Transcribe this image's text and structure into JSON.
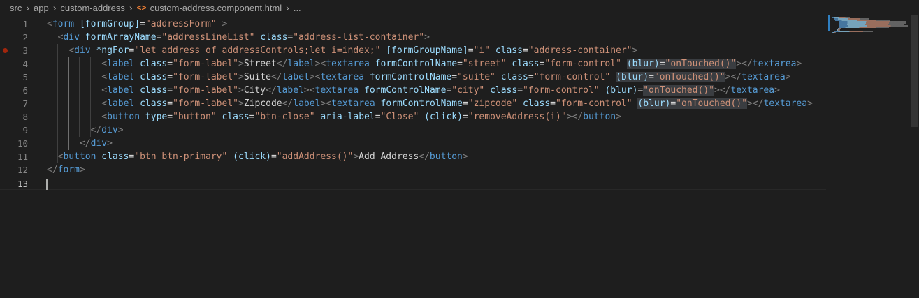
{
  "breadcrumb": {
    "items": [
      "src",
      "app",
      "custom-address",
      "custom-address.component.html",
      "..."
    ],
    "separator": "›",
    "file_icon": "<>"
  },
  "editor": {
    "cursor_line": 13,
    "breakpoint_line": 3,
    "lines": [
      {
        "n": "1",
        "indent": 0,
        "segments": [
          {
            "t": "<",
            "c": "tb"
          },
          {
            "t": "form",
            "c": "tg"
          },
          {
            "t": " "
          },
          {
            "t": "[formGroup]",
            "c": "at"
          },
          {
            "t": "=",
            "c": "eq"
          },
          {
            "t": "\"addressForm\"",
            "c": "st"
          },
          {
            "t": " "
          },
          {
            "t": ">",
            "c": "tb"
          }
        ]
      },
      {
        "n": "2",
        "indent": 1,
        "segments": [
          {
            "t": "<",
            "c": "tb"
          },
          {
            "t": "div",
            "c": "tg"
          },
          {
            "t": " "
          },
          {
            "t": "formArrayName",
            "c": "at"
          },
          {
            "t": "=",
            "c": "eq"
          },
          {
            "t": "\"addressLineList\"",
            "c": "st"
          },
          {
            "t": " "
          },
          {
            "t": "class",
            "c": "at"
          },
          {
            "t": "=",
            "c": "eq"
          },
          {
            "t": "\"address-list-container\"",
            "c": "st"
          },
          {
            "t": ">",
            "c": "tb"
          }
        ]
      },
      {
        "n": "3",
        "indent": 2,
        "segments": [
          {
            "t": "<",
            "c": "tb"
          },
          {
            "t": "div",
            "c": "tg"
          },
          {
            "t": " "
          },
          {
            "t": "*ngFor",
            "c": "at"
          },
          {
            "t": "=",
            "c": "eq"
          },
          {
            "t": "\"let address of addressControls;let i=index;\"",
            "c": "st"
          },
          {
            "t": " "
          },
          {
            "t": "[formGroupName]",
            "c": "at"
          },
          {
            "t": "=",
            "c": "eq"
          },
          {
            "t": "\"i\"",
            "c": "st"
          },
          {
            "t": " "
          },
          {
            "t": "class",
            "c": "at"
          },
          {
            "t": "=",
            "c": "eq"
          },
          {
            "t": "\"address-container\"",
            "c": "st"
          },
          {
            "t": ">",
            "c": "tb"
          }
        ]
      },
      {
        "n": "4",
        "indent": 5,
        "segments": [
          {
            "t": "<",
            "c": "tb"
          },
          {
            "t": "label",
            "c": "tg"
          },
          {
            "t": " "
          },
          {
            "t": "class",
            "c": "at"
          },
          {
            "t": "=",
            "c": "eq"
          },
          {
            "t": "\"form-label\"",
            "c": "st"
          },
          {
            "t": ">",
            "c": "tb"
          },
          {
            "t": "Street",
            "c": "tx"
          },
          {
            "t": "</",
            "c": "tb"
          },
          {
            "t": "label",
            "c": "tg"
          },
          {
            "t": ">",
            "c": "tb"
          },
          {
            "t": "<",
            "c": "tb"
          },
          {
            "t": "textarea",
            "c": "tg"
          },
          {
            "t": " "
          },
          {
            "t": "formControlName",
            "c": "at"
          },
          {
            "t": "=",
            "c": "eq"
          },
          {
            "t": "\"street\"",
            "c": "st"
          },
          {
            "t": " "
          },
          {
            "t": "class",
            "c": "at"
          },
          {
            "t": "=",
            "c": "eq"
          },
          {
            "t": "\"form-control\"",
            "c": "st"
          },
          {
            "t": " "
          },
          {
            "t": "(blur)",
            "c": "at hl"
          },
          {
            "t": "=",
            "c": "eq hl"
          },
          {
            "t": "\"onTouched()\"",
            "c": "st hl"
          },
          {
            "t": ">",
            "c": "tb"
          },
          {
            "t": "</",
            "c": "tb"
          },
          {
            "t": "textarea",
            "c": "tg"
          },
          {
            "t": ">",
            "c": "tb"
          }
        ]
      },
      {
        "n": "5",
        "indent": 5,
        "segments": [
          {
            "t": "<",
            "c": "tb"
          },
          {
            "t": "label",
            "c": "tg"
          },
          {
            "t": " "
          },
          {
            "t": "class",
            "c": "at"
          },
          {
            "t": "=",
            "c": "eq"
          },
          {
            "t": "\"form-label\"",
            "c": "st"
          },
          {
            "t": ">",
            "c": "tb"
          },
          {
            "t": "Suite",
            "c": "tx"
          },
          {
            "t": "</",
            "c": "tb"
          },
          {
            "t": "label",
            "c": "tg"
          },
          {
            "t": ">",
            "c": "tb"
          },
          {
            "t": "<",
            "c": "tb"
          },
          {
            "t": "textarea",
            "c": "tg"
          },
          {
            "t": " "
          },
          {
            "t": "formControlName",
            "c": "at"
          },
          {
            "t": "=",
            "c": "eq"
          },
          {
            "t": "\"suite\"",
            "c": "st"
          },
          {
            "t": " "
          },
          {
            "t": "class",
            "c": "at"
          },
          {
            "t": "=",
            "c": "eq"
          },
          {
            "t": "\"form-control\"",
            "c": "st"
          },
          {
            "t": " "
          },
          {
            "t": "(blur)",
            "c": "at hl"
          },
          {
            "t": "=",
            "c": "eq hl"
          },
          {
            "t": "\"onTouched()\"",
            "c": "st hl"
          },
          {
            "t": ">",
            "c": "tb"
          },
          {
            "t": "</",
            "c": "tb"
          },
          {
            "t": "textarea",
            "c": "tg"
          },
          {
            "t": ">",
            "c": "tb"
          }
        ]
      },
      {
        "n": "6",
        "indent": 5,
        "segments": [
          {
            "t": "<",
            "c": "tb"
          },
          {
            "t": "label",
            "c": "tg"
          },
          {
            "t": " "
          },
          {
            "t": "class",
            "c": "at"
          },
          {
            "t": "=",
            "c": "eq"
          },
          {
            "t": "\"form-label\"",
            "c": "st"
          },
          {
            "t": ">",
            "c": "tb"
          },
          {
            "t": "City",
            "c": "tx"
          },
          {
            "t": "</",
            "c": "tb"
          },
          {
            "t": "label",
            "c": "tg"
          },
          {
            "t": ">",
            "c": "tb"
          },
          {
            "t": "<",
            "c": "tb"
          },
          {
            "t": "textarea",
            "c": "tg"
          },
          {
            "t": " "
          },
          {
            "t": "formControlName",
            "c": "at"
          },
          {
            "t": "=",
            "c": "eq"
          },
          {
            "t": "\"city\"",
            "c": "st"
          },
          {
            "t": " "
          },
          {
            "t": "class",
            "c": "at"
          },
          {
            "t": "=",
            "c": "eq"
          },
          {
            "t": "\"form-control\"",
            "c": "st"
          },
          {
            "t": " "
          },
          {
            "t": "(blur)",
            "c": "at"
          },
          {
            "t": "=",
            "c": "eq"
          },
          {
            "t": "\"onTouched()\"",
            "c": "st hl"
          },
          {
            "t": ">",
            "c": "tb"
          },
          {
            "t": "</",
            "c": "tb"
          },
          {
            "t": "textarea",
            "c": "tg"
          },
          {
            "t": ">",
            "c": "tb"
          }
        ]
      },
      {
        "n": "7",
        "indent": 5,
        "segments": [
          {
            "t": "<",
            "c": "tb"
          },
          {
            "t": "label",
            "c": "tg"
          },
          {
            "t": " "
          },
          {
            "t": "class",
            "c": "at"
          },
          {
            "t": "=",
            "c": "eq"
          },
          {
            "t": "\"form-label\"",
            "c": "st"
          },
          {
            "t": ">",
            "c": "tb"
          },
          {
            "t": "Zipcode",
            "c": "tx"
          },
          {
            "t": "</",
            "c": "tb"
          },
          {
            "t": "label",
            "c": "tg"
          },
          {
            "t": ">",
            "c": "tb"
          },
          {
            "t": "<",
            "c": "tb"
          },
          {
            "t": "textarea",
            "c": "tg"
          },
          {
            "t": " "
          },
          {
            "t": "formControlName",
            "c": "at"
          },
          {
            "t": "=",
            "c": "eq"
          },
          {
            "t": "\"zipcode\"",
            "c": "st"
          },
          {
            "t": " "
          },
          {
            "t": "class",
            "c": "at"
          },
          {
            "t": "=",
            "c": "eq"
          },
          {
            "t": "\"form-control\"",
            "c": "st"
          },
          {
            "t": " "
          },
          {
            "t": "(blur)",
            "c": "at hl"
          },
          {
            "t": "=",
            "c": "eq hl"
          },
          {
            "t": "\"onTouched()\"",
            "c": "st hl"
          },
          {
            "t": ">",
            "c": "tb"
          },
          {
            "t": "</",
            "c": "tb"
          },
          {
            "t": "textarea",
            "c": "tg"
          },
          {
            "t": ">",
            "c": "tb"
          }
        ]
      },
      {
        "n": "8",
        "indent": 5,
        "segments": [
          {
            "t": "<",
            "c": "tb"
          },
          {
            "t": "button",
            "c": "tg"
          },
          {
            "t": " "
          },
          {
            "t": "type",
            "c": "at"
          },
          {
            "t": "=",
            "c": "eq"
          },
          {
            "t": "\"button\"",
            "c": "st"
          },
          {
            "t": " "
          },
          {
            "t": "class",
            "c": "at"
          },
          {
            "t": "=",
            "c": "eq"
          },
          {
            "t": "\"btn-close\"",
            "c": "st"
          },
          {
            "t": " "
          },
          {
            "t": "aria-label",
            "c": "at"
          },
          {
            "t": "=",
            "c": "eq"
          },
          {
            "t": "\"Close\"",
            "c": "st"
          },
          {
            "t": " "
          },
          {
            "t": "(click)",
            "c": "at"
          },
          {
            "t": "=",
            "c": "eq"
          },
          {
            "t": "\"removeAddress(i)\"",
            "c": "st"
          },
          {
            "t": ">",
            "c": "tb"
          },
          {
            "t": "</",
            "c": "tb"
          },
          {
            "t": "button",
            "c": "tg"
          },
          {
            "t": ">",
            "c": "tb"
          }
        ]
      },
      {
        "n": "9",
        "indent": 4,
        "segments": [
          {
            "t": "</",
            "c": "tb"
          },
          {
            "t": "div",
            "c": "tg"
          },
          {
            "t": ">",
            "c": "tb"
          }
        ]
      },
      {
        "n": "10",
        "indent": 3,
        "segments": [
          {
            "t": "</",
            "c": "tb"
          },
          {
            "t": "div",
            "c": "tg"
          },
          {
            "t": ">",
            "c": "tb"
          }
        ]
      },
      {
        "n": "11",
        "indent": 1,
        "segments": [
          {
            "t": "<",
            "c": "tb"
          },
          {
            "t": "button",
            "c": "tg"
          },
          {
            "t": " "
          },
          {
            "t": "class",
            "c": "at"
          },
          {
            "t": "=",
            "c": "eq"
          },
          {
            "t": "\"btn btn-primary\"",
            "c": "st"
          },
          {
            "t": " "
          },
          {
            "t": "(click)",
            "c": "at"
          },
          {
            "t": "=",
            "c": "eq"
          },
          {
            "t": "\"addAddress()\"",
            "c": "st"
          },
          {
            "t": ">",
            "c": "tb"
          },
          {
            "t": "Add Address",
            "c": "tx"
          },
          {
            "t": "</",
            "c": "tb"
          },
          {
            "t": "button",
            "c": "tg"
          },
          {
            "t": ">",
            "c": "tb"
          }
        ]
      },
      {
        "n": "12",
        "indent": 0,
        "segments": [
          {
            "t": "</",
            "c": "tb"
          },
          {
            "t": "form",
            "c": "tg"
          },
          {
            "t": ">",
            "c": "tb"
          }
        ]
      },
      {
        "n": "13",
        "indent": 0,
        "segments": []
      }
    ]
  },
  "colors": {
    "background": "#1e1e1e",
    "tag": "#569cd6",
    "attribute": "#9cdcfe",
    "string": "#ce9178",
    "bracket": "#808080",
    "text": "#d4d4d4",
    "breakpoint": "#a1260d",
    "line_number": "#858585"
  }
}
